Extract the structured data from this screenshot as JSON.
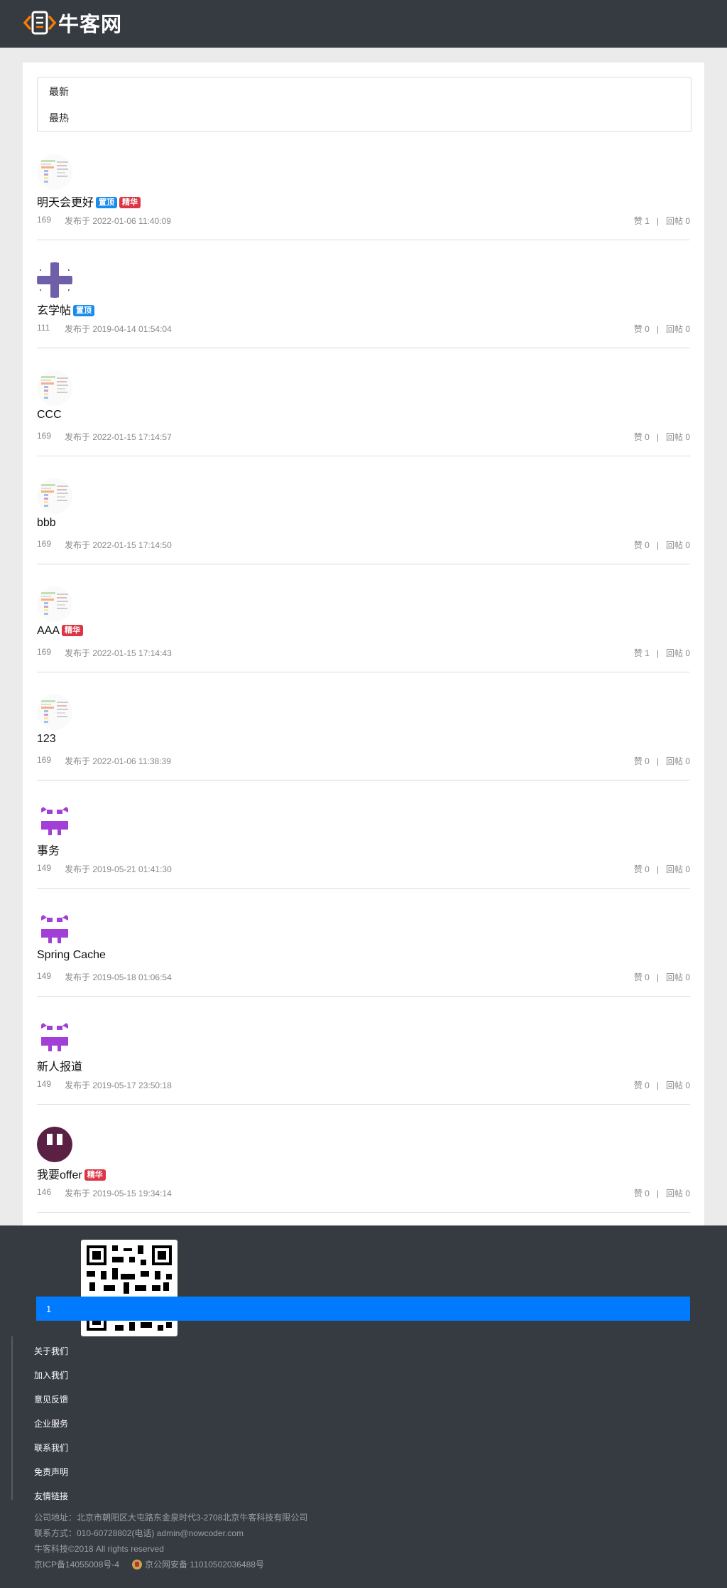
{
  "header": {
    "logo_text": "牛客网"
  },
  "tabs": {
    "latest": "最新",
    "hottest": "最热"
  },
  "posts": [
    {
      "title": "明天会更好",
      "badges": [
        "置顶",
        "精华"
      ],
      "author": "169",
      "time": "发布于 2022-01-06 11:40:09",
      "likes": "赞 1",
      "replies": "回帖 0",
      "avatar": "chart"
    },
    {
      "title": "玄学帖",
      "badges": [
        "置顶"
      ],
      "author": "111",
      "time": "发布于 2019-04-14 01:54:04",
      "likes": "赞 0",
      "replies": "回帖 0",
      "avatar": "pixel-purple-plus"
    },
    {
      "title": "CCC",
      "badges": [],
      "author": "169",
      "time": "发布于 2022-01-15 17:14:57",
      "likes": "赞 0",
      "replies": "回帖 0",
      "avatar": "chart"
    },
    {
      "title": "bbb",
      "badges": [],
      "author": "169",
      "time": "发布于 2022-01-15 17:14:50",
      "likes": "赞 0",
      "replies": "回帖 0",
      "avatar": "chart"
    },
    {
      "title": "AAA",
      "badges": [
        "精华"
      ],
      "author": "169",
      "time": "发布于 2022-01-15 17:14:43",
      "likes": "赞 1",
      "replies": "回帖 0",
      "avatar": "chart"
    },
    {
      "title": "123",
      "badges": [],
      "author": "169",
      "time": "发布于 2022-01-06 11:38:39",
      "likes": "赞 0",
      "replies": "回帖 0",
      "avatar": "chart"
    },
    {
      "title": "事务",
      "badges": [],
      "author": "149",
      "time": "发布于 2019-05-21 01:41:30",
      "likes": "赞 0",
      "replies": "回帖 0",
      "avatar": "pixel-magenta"
    },
    {
      "title": "Spring Cache",
      "badges": [],
      "author": "149",
      "time": "发布于 2019-05-18 01:06:54",
      "likes": "赞 0",
      "replies": "回帖 0",
      "avatar": "pixel-magenta"
    },
    {
      "title": "新人报道",
      "badges": [],
      "author": "149",
      "time": "发布于 2019-05-17 23:50:18",
      "likes": "赞 0",
      "replies": "回帖 0",
      "avatar": "pixel-magenta"
    },
    {
      "title": "我要offer",
      "badges": [
        "精华"
      ],
      "author": "146",
      "time": "发布于 2019-05-15 19:34:14",
      "likes": "赞 0",
      "replies": "回帖 0",
      "avatar": "circle-dark"
    }
  ],
  "pagination": {
    "current": "1"
  },
  "footer": {
    "links": [
      "关于我们",
      "加入我们",
      "意见反馈",
      "企业服务",
      "联系我们",
      "免责声明",
      "友情链接"
    ],
    "address": "公司地址：北京市朝阳区大屯路东金泉时代3-2708北京牛客科技有限公司",
    "contact": "联系方式：010-60728802(电话)    admin@nowcoder.com",
    "copyright": "牛客科技©2018 All rights reserved",
    "icp": "京ICP备14055008号-4",
    "police": "京公网安备 11010502036488号"
  },
  "colors": {
    "header_bg": "#363a41",
    "accent": "#007bff",
    "badge_top": "#1a8ceb",
    "badge_best": "#dc3545"
  }
}
